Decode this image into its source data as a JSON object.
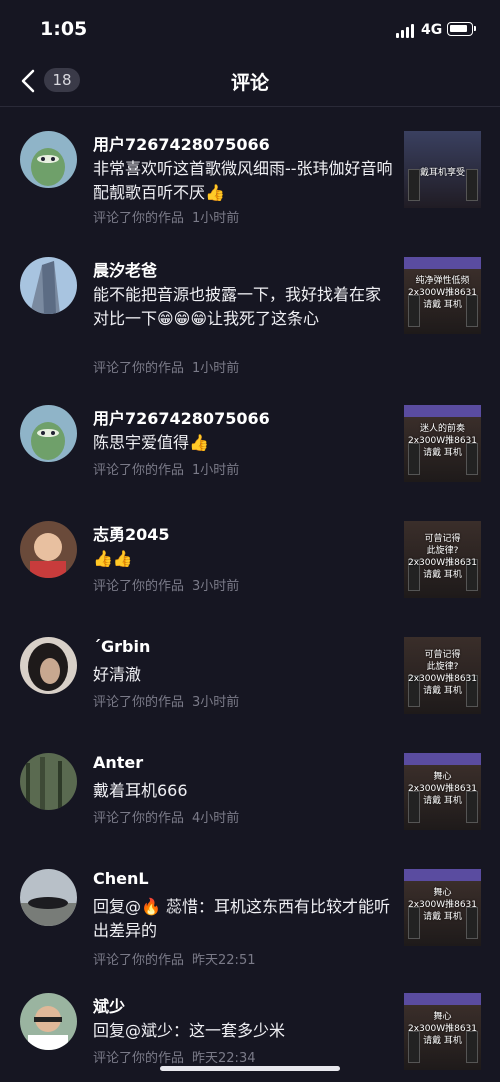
{
  "status": {
    "time": "1:05",
    "network": "4G"
  },
  "nav": {
    "badge": "18",
    "title": "评论"
  },
  "comments": [
    {
      "user": "用户7267428075066",
      "text": "非常喜欢听这首歌微风细雨--张玮伽好音响配靓歌百听不厌👍",
      "action": "评论了你的作品",
      "time": "1小时前",
      "thumb_caption": "戴耳机享受"
    },
    {
      "user": "晨汐老爸",
      "text": "能不能把音源也披露一下，我好找着在家对比一下😁😁😁让我死了这条心",
      "action": "评论了你的作品",
      "time": "1小时前",
      "thumb_caption": "纯净弹性低频\n2x300W推8631\n请戴  耳机"
    },
    {
      "user": "用户7267428075066",
      "text": "陈思宇爱值得👍",
      "action": "评论了你的作品",
      "time": "1小时前",
      "thumb_caption": "迷人的前奏\n2x300W推8631\n请戴  耳机"
    },
    {
      "user": "志勇2045",
      "text": "👍👍",
      "action": "评论了你的作品",
      "time": "3小时前",
      "thumb_caption": "可曾记得\n此旋律?\n2x300W推8631\n请戴  耳机"
    },
    {
      "user": "´Grbin",
      "text": "好清澈",
      "action": "评论了你的作品",
      "time": "3小时前",
      "thumb_caption": "可曾记得\n此旋律?\n2x300W推8631\n请戴  耳机"
    },
    {
      "user": "Anter",
      "text": "戴着耳机666",
      "action": "评论了你的作品",
      "time": "4小时前",
      "thumb_caption": "舞心\n2x300W推8631\n请戴  耳机"
    },
    {
      "user": "ChenL",
      "text": "回复@🔥 蕊惜：耳机这东西有比较才能听出差异的",
      "action": "评论了你的作品",
      "time": "昨天22:51",
      "thumb_caption": "舞心\n2x300W推8631\n请戴  耳机"
    },
    {
      "user": "斌少",
      "text": "回复@斌少：这一套多少米",
      "action": "评论了你的作品",
      "time": "昨天22:34",
      "thumb_caption": "舞心\n2x300W推8631\n请戴  耳机"
    }
  ],
  "colors": {
    "background": "#161622",
    "secondary_text": "#7a7a88"
  }
}
